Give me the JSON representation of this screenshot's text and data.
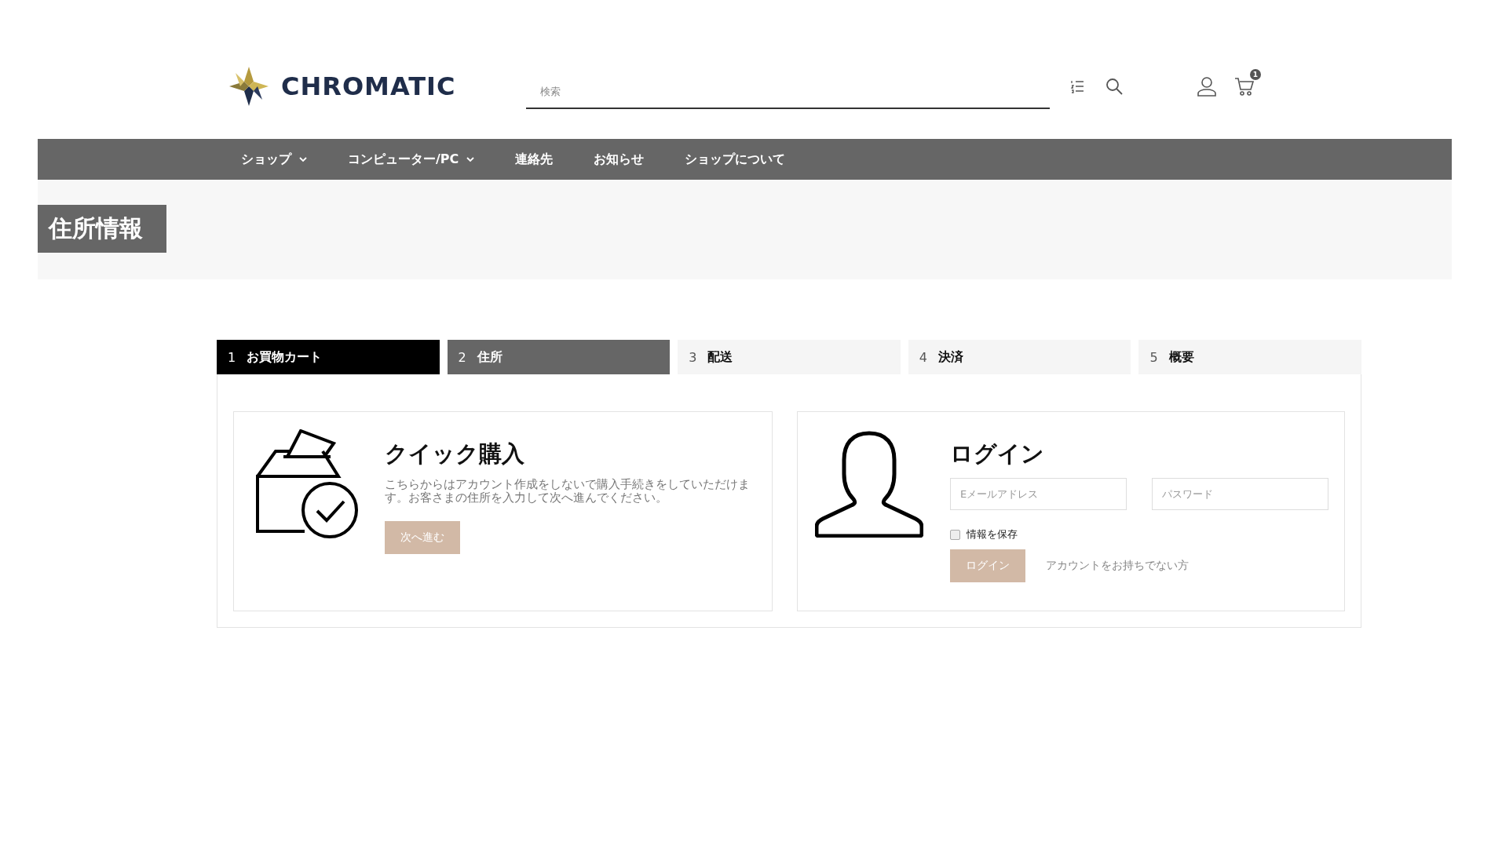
{
  "header": {
    "logo_text": "CHROMATIC",
    "search": {
      "placeholder": "検索"
    },
    "cart_count": "1"
  },
  "nav": [
    {
      "label": "ショップ",
      "dropdown": true
    },
    {
      "label": "コンピューター/PC",
      "dropdown": true
    },
    {
      "label": "連絡先",
      "dropdown": false
    },
    {
      "label": "お知らせ",
      "dropdown": false
    },
    {
      "label": "ショップについて",
      "dropdown": false
    }
  ],
  "page_title": "住所情報",
  "steps": [
    {
      "number": "1",
      "label": "お買物カート",
      "completed": true,
      "selected": false
    },
    {
      "number": "2",
      "label": "住所",
      "completed": false,
      "selected": true
    },
    {
      "number": "3",
      "label": "配送",
      "completed": false,
      "selected": false
    },
    {
      "number": "4",
      "label": "決済",
      "completed": false,
      "selected": false
    },
    {
      "number": "5",
      "label": "概要",
      "completed": false,
      "selected": false
    }
  ],
  "quick_buy": {
    "title": "クイック購入",
    "text": "こちらからはアカウント作成をしないで購入手続きをしていただけます。お客さまの住所を入力して次へ進んでください。",
    "button": "次へ進む"
  },
  "login": {
    "title": "ログイン",
    "email": {
      "placeholder": "Eメールアドレス"
    },
    "password": {
      "placeholder": "パスワード"
    },
    "remember": {
      "label": "情報を保存",
      "checked": false
    },
    "button": "ログイン",
    "no_account_link": "アカウントをお持ちでない方"
  }
}
